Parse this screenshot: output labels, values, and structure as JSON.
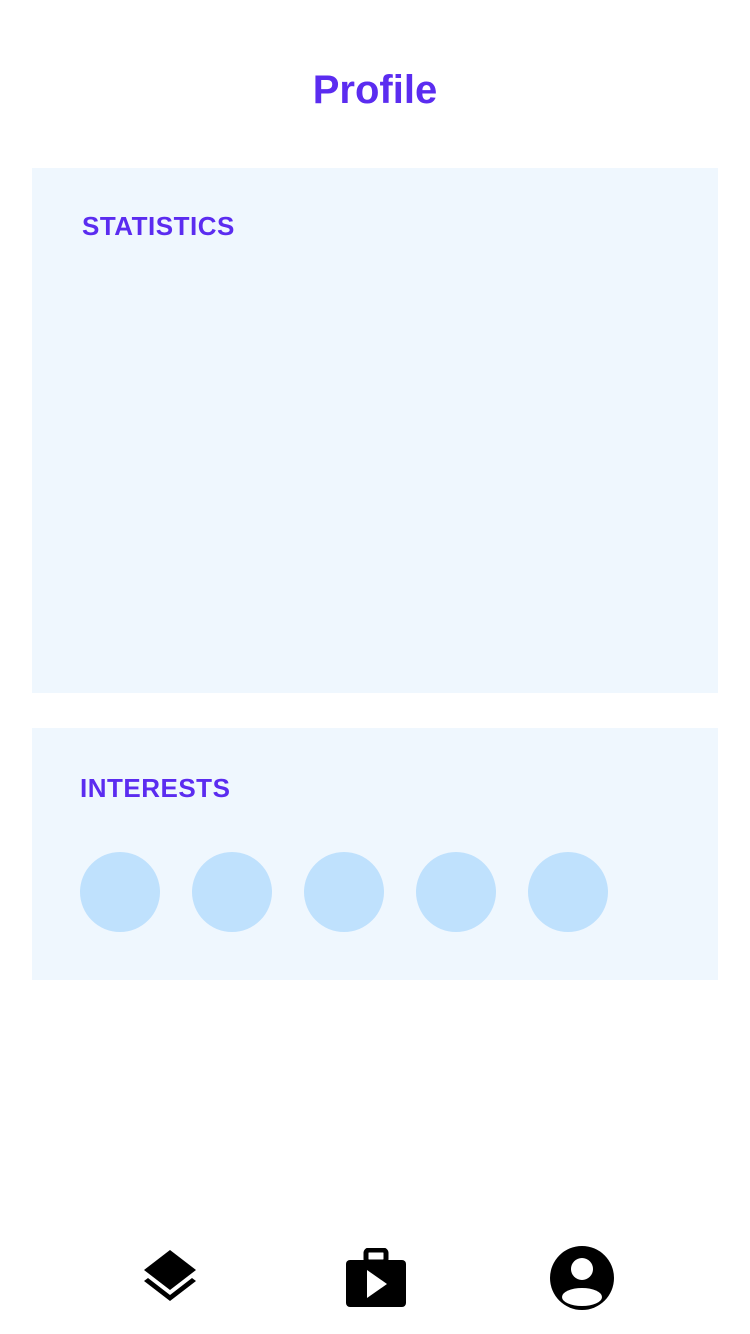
{
  "header": {
    "title": "Profile"
  },
  "statistics": {
    "heading": "STATISTICS"
  },
  "interests": {
    "heading": "INTERESTS",
    "items": [
      {
        "icon": "interest-placeholder"
      },
      {
        "icon": "interest-placeholder"
      },
      {
        "icon": "interest-placeholder"
      },
      {
        "icon": "interest-placeholder"
      },
      {
        "icon": "interest-placeholder"
      }
    ]
  },
  "bottom_nav": {
    "items": [
      {
        "icon": "layers-icon"
      },
      {
        "icon": "shop-play-icon"
      },
      {
        "icon": "account-circle-icon"
      }
    ]
  },
  "colors": {
    "accent": "#5b2cf0",
    "card_background": "#eff7fe",
    "interest_circle": "#bfe1fd",
    "icon": "#000000"
  }
}
